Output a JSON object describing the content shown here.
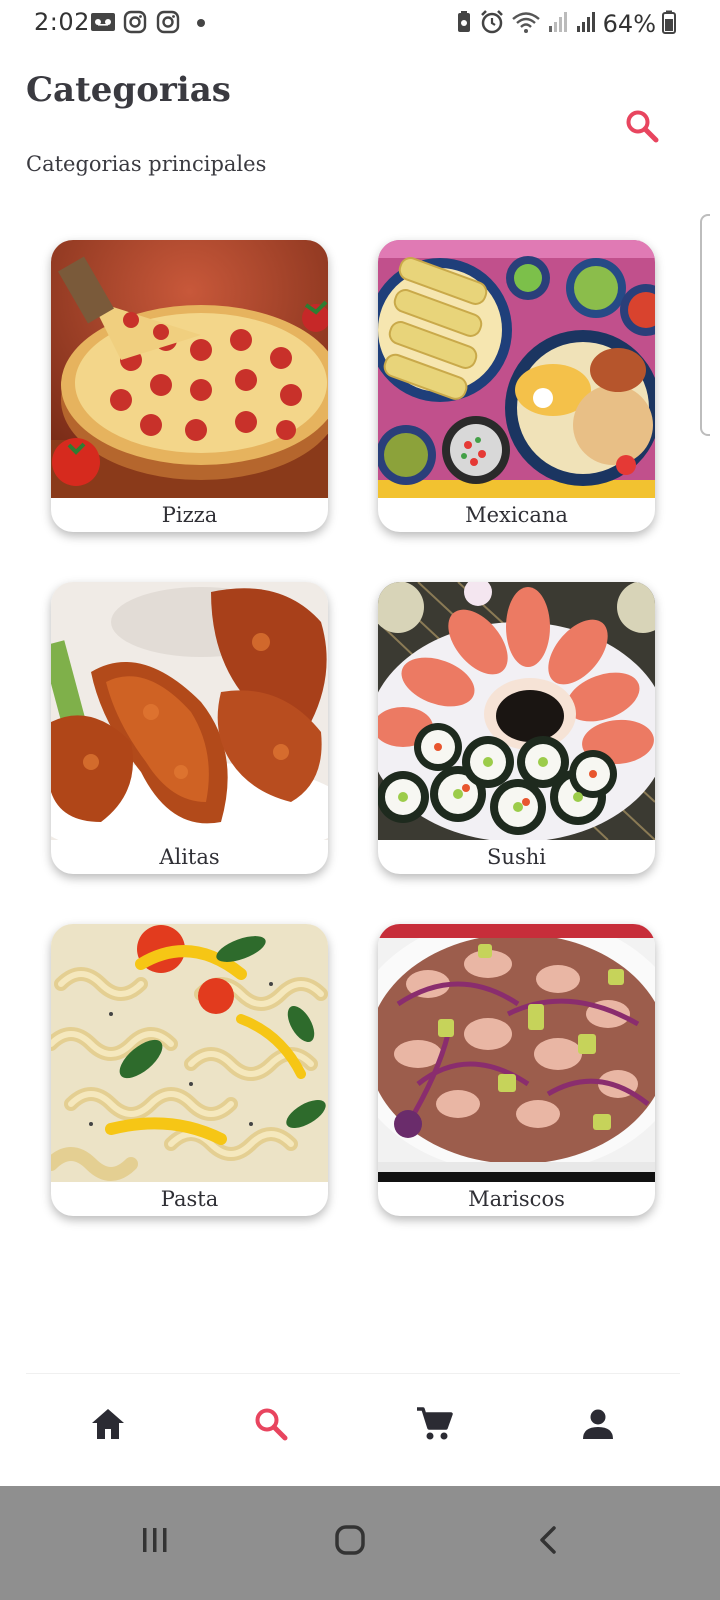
{
  "status_bar": {
    "time": "2:02",
    "battery_text": "64%",
    "icons_left": [
      "voicemail-icon",
      "instagram-icon",
      "instagram-icon",
      "notification-dot-icon"
    ],
    "icons_right": [
      "battery-saver-icon",
      "alarm-icon",
      "wifi-icon",
      "signal-icon",
      "signal-icon",
      "battery-icon"
    ]
  },
  "header": {
    "title": "Categorias",
    "subtitle": "Categorias principales",
    "search_icon": "search-icon"
  },
  "categories": [
    {
      "label": "Pizza",
      "photo": "pizza-photo"
    },
    {
      "label": "Mexicana",
      "photo": "mexican-food-photo"
    },
    {
      "label": "Alitas",
      "photo": "chicken-wings-photo"
    },
    {
      "label": "Sushi",
      "photo": "sushi-photo"
    },
    {
      "label": "Pasta",
      "photo": "pasta-photo"
    },
    {
      "label": "Mariscos",
      "photo": "seafood-photo"
    }
  ],
  "bottom_nav": {
    "items": [
      {
        "icon": "home-icon",
        "active": false
      },
      {
        "icon": "search-icon",
        "active": true
      },
      {
        "icon": "cart-icon",
        "active": false
      },
      {
        "icon": "person-icon",
        "active": false
      }
    ]
  },
  "system_nav": {
    "items": [
      "recents-icon",
      "home-circle-icon",
      "back-icon"
    ]
  },
  "colors": {
    "accent": "#e8455f",
    "text": "#2f2f35",
    "nav_icon": "#2b2b33",
    "system_nav_bg": "#8f8f8f"
  }
}
